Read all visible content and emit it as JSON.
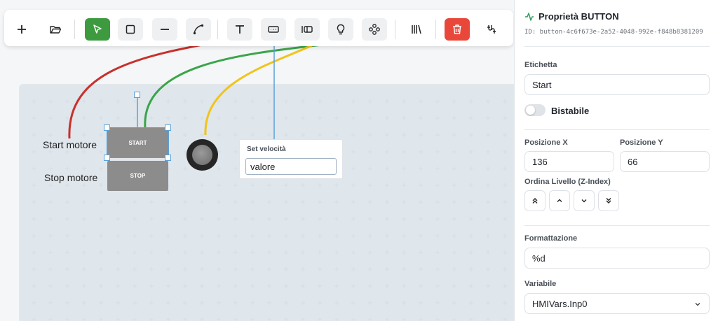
{
  "toolbar": {
    "buttons": [
      {
        "name": "add-button",
        "icon": "plus-icon"
      },
      {
        "name": "open-button",
        "icon": "folder-open-icon"
      },
      {
        "name": "select-tool-button",
        "icon": "cursor-arrow-icon",
        "active": true
      },
      {
        "name": "rectangle-tool-button",
        "icon": "square-icon"
      },
      {
        "name": "line-tool-button",
        "icon": "minus-icon"
      },
      {
        "name": "curve-tool-button",
        "icon": "curve-icon"
      },
      {
        "name": "text-tool-button",
        "icon": "text-t-icon"
      },
      {
        "name": "input-tool-button",
        "icon": "input-box-icon"
      },
      {
        "name": "button-tool-button",
        "icon": "button-icon"
      },
      {
        "name": "lamp-tool-button",
        "icon": "lightbulb-icon"
      },
      {
        "name": "component-tool-button",
        "icon": "component-icon"
      },
      {
        "name": "library-button",
        "icon": "library-icon"
      },
      {
        "name": "delete-button",
        "icon": "trash-icon"
      },
      {
        "name": "variables-button",
        "icon": "variables-icon"
      }
    ],
    "colors": {
      "active": "#3d9a3f",
      "danger": "#e8473a"
    }
  },
  "canvas": {
    "labels": {
      "start": "Start motore",
      "stop": "Stop motore"
    },
    "buttons": {
      "start": "START",
      "stop": "STOP"
    },
    "input_widget": {
      "label": "Set velocità",
      "value": "valore"
    },
    "wire_colors": {
      "red": "#c9302c",
      "green": "#3aa548",
      "yellow": "#f0c419",
      "blue": "#5aa0d8"
    }
  },
  "panel": {
    "title": "Proprietà BUTTON",
    "id_text": "ID: button-4c6f673e-2a52-4048-992e-f848b8381209",
    "accent": "#2e9e5b",
    "etichetta": {
      "label": "Etichetta",
      "value": "Start"
    },
    "bistabile": {
      "label": "Bistabile",
      "on": false
    },
    "pos_x": {
      "label": "Posizione X",
      "value": "136"
    },
    "pos_y": {
      "label": "Posizione Y",
      "value": "66"
    },
    "zindex": {
      "label": "Ordina Livello (Z-Index)"
    },
    "formattazione": {
      "label": "Formattazione",
      "value": "%d"
    },
    "variabile": {
      "label": "Variabile",
      "value": "HMIVars.Inp0"
    }
  }
}
